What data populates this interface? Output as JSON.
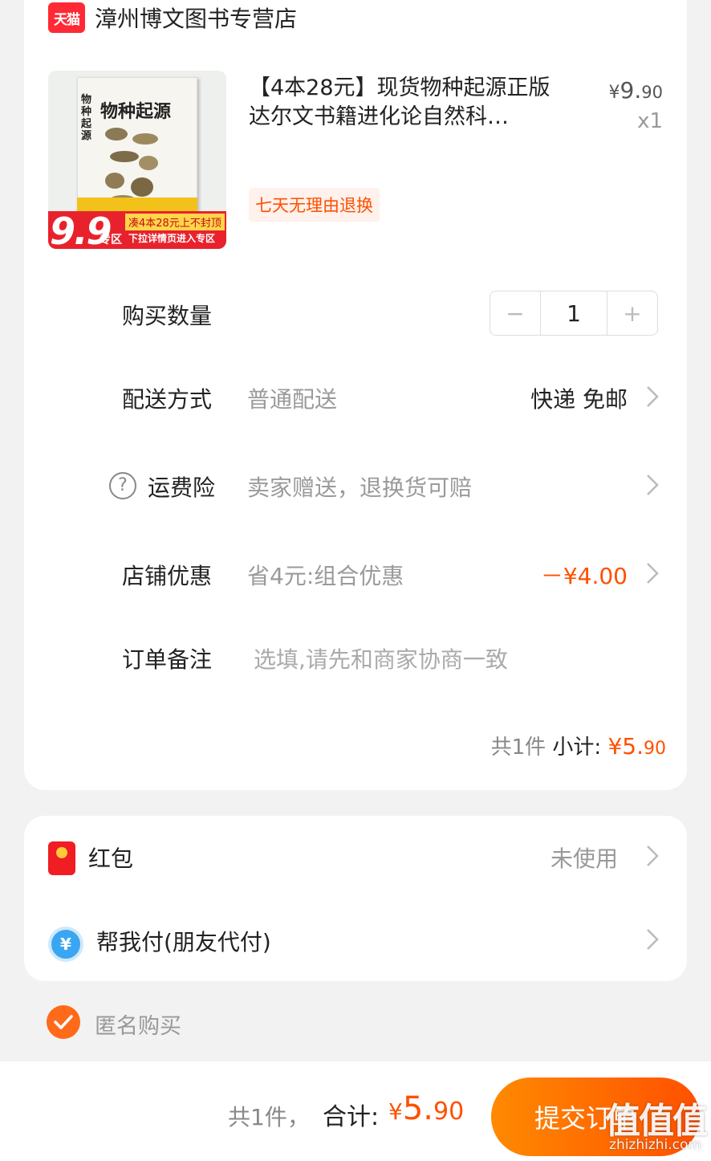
{
  "shop": {
    "name": "漳州博文图书专营店",
    "badge": "天猫"
  },
  "product": {
    "title": "【4本28元】现货物种起源正版达尔文书籍进化论自然科…",
    "price_yen": "¥",
    "price_int": "9.",
    "price_dec": "90",
    "quantity_label": "x1",
    "return_tag": "七天无理由退换",
    "cover": {
      "title": "物种起源",
      "vertical_title": "物种起源",
      "promo_price": "9.9",
      "promo_zone": "专区",
      "promo_tag": "凑4本28元上不封顶",
      "promo_sub": "下拉详情页进入专区"
    }
  },
  "quantity": {
    "label": "购买数量",
    "value": "1",
    "minus": "−",
    "plus": "+"
  },
  "delivery": {
    "label": "配送方式",
    "value": "普通配送",
    "right": "快递 免邮"
  },
  "insurance": {
    "label": "运费险",
    "value": "卖家赠送，退换货可赔",
    "help": "?"
  },
  "discount": {
    "label": "店铺优惠",
    "value": "省4元:组合优惠",
    "amount": "－¥4.00"
  },
  "note": {
    "label": "订单备注",
    "placeholder": "选填,请先和商家协商一致"
  },
  "subtotal": {
    "count": "共1件",
    "label": "小计:",
    "yen": "¥",
    "int": "5.",
    "dec": "90"
  },
  "red_packet": {
    "label": "红包",
    "value": "未使用"
  },
  "friend_pay": {
    "label": "帮我付(朋友代付)",
    "icon_glyph": "¥"
  },
  "anonymous": {
    "label": "匿名购买",
    "checked": true
  },
  "footer": {
    "count": "共1件，",
    "total_label": "合计:",
    "yen": "¥",
    "int": "5.",
    "dec": "90",
    "submit": "提交订单"
  },
  "watermark": {
    "logo": "值值值",
    "url": "zhizhizhi.com"
  },
  "colors": {
    "accent": "#ff5000",
    "tmall_red": "#ff2a36",
    "background": "#f2f2f2"
  }
}
